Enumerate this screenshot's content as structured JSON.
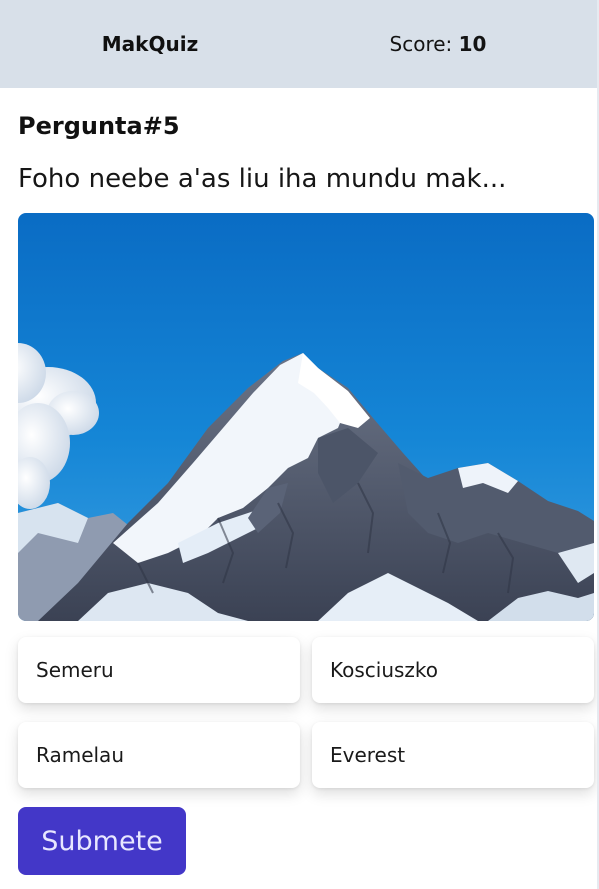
{
  "header": {
    "brand": "MakQuiz",
    "score_label": "Score:",
    "score_value": "10"
  },
  "question": {
    "number_label": "Pergunta#5",
    "text": "Foho neebe a'as liu iha mundu mak..."
  },
  "image": {
    "subject": "snow-capped mountain peak under blue sky"
  },
  "options": [
    {
      "label": "Semeru"
    },
    {
      "label": "Kosciuszko"
    },
    {
      "label": "Ramelau"
    },
    {
      "label": "Everest"
    }
  ],
  "submit": {
    "label": "Submete"
  },
  "colors": {
    "header_bg": "#d8e0e9",
    "submit_bg": "#4337c8",
    "sky": "#0876cc"
  }
}
